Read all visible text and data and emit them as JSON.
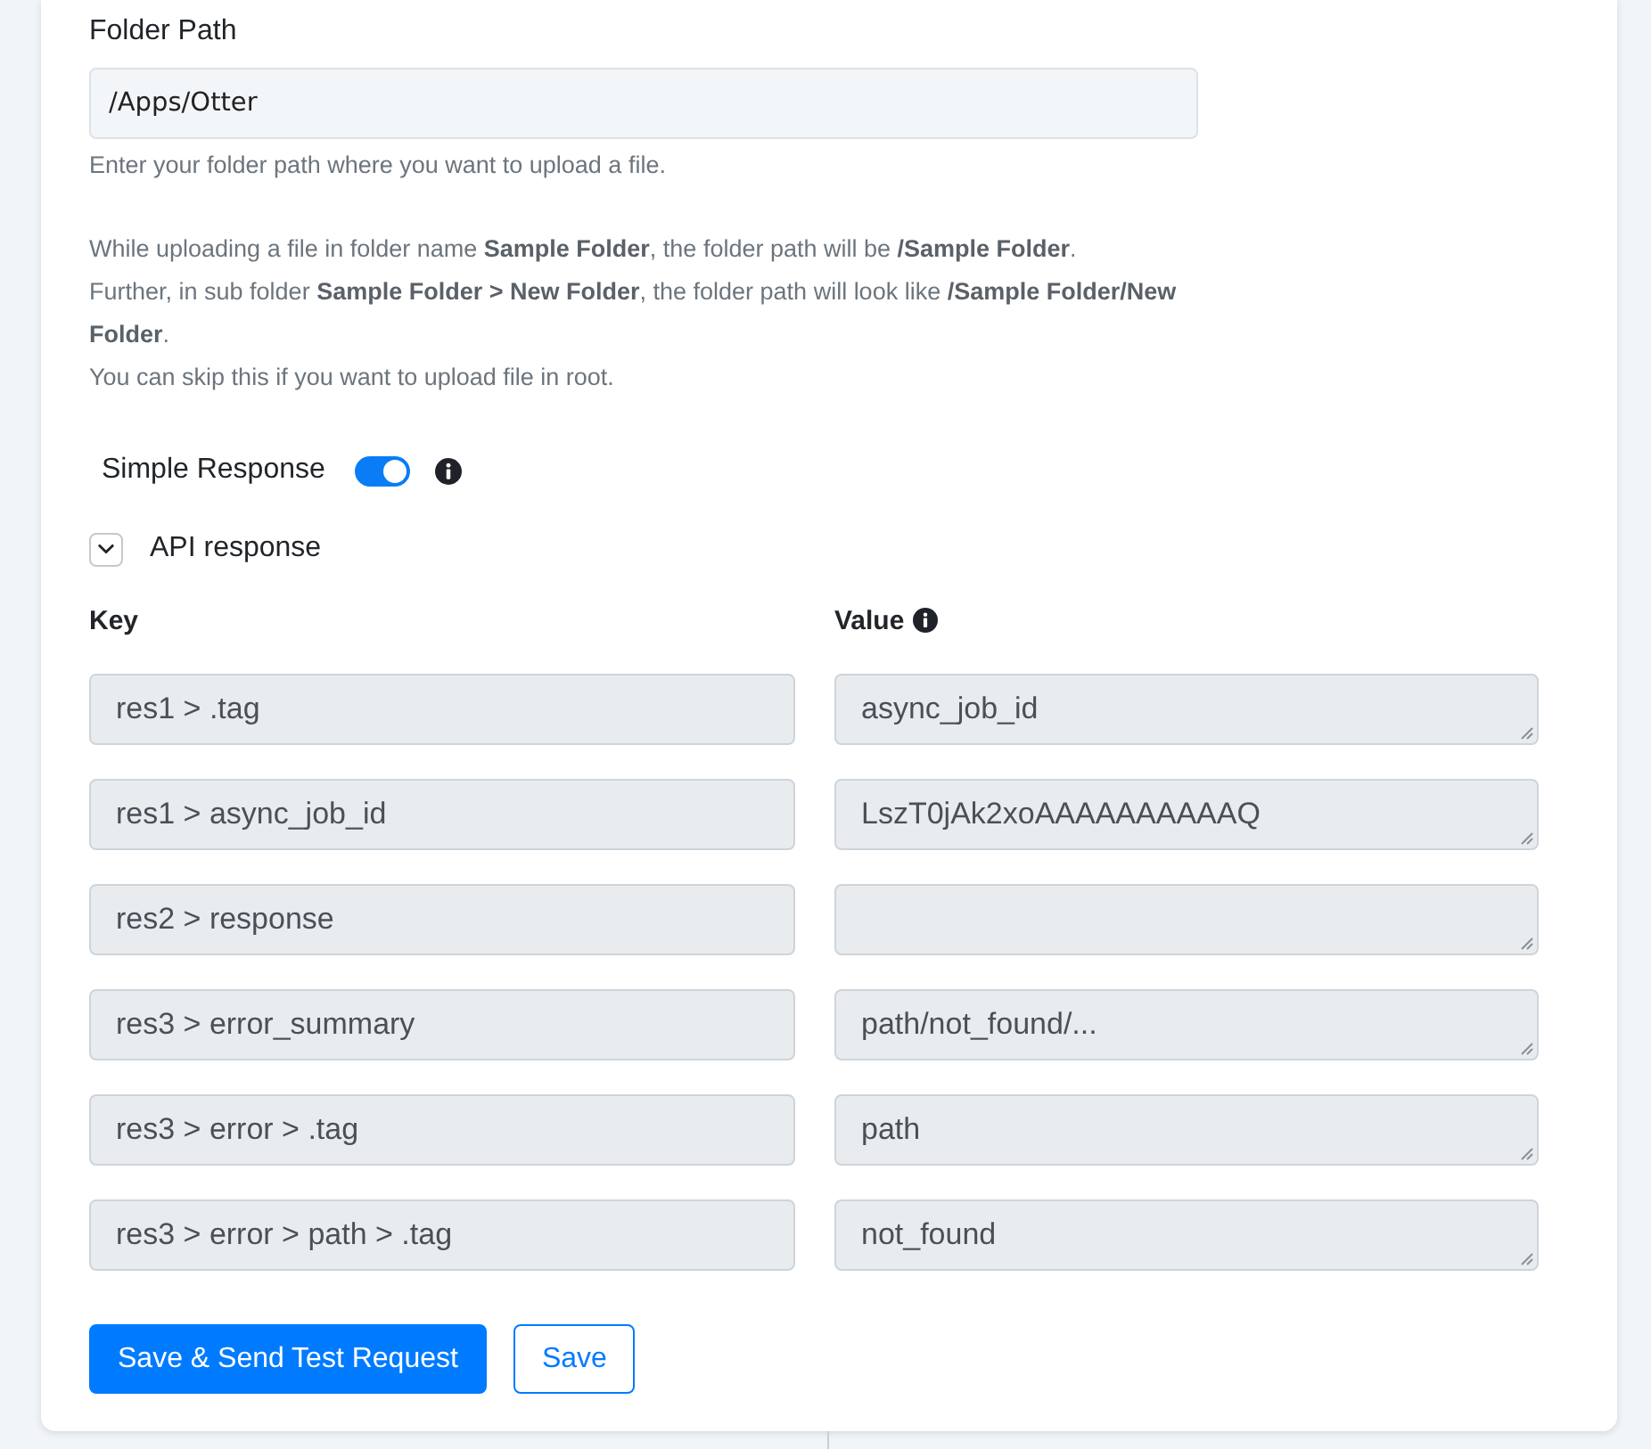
{
  "folder_path": {
    "label": "Folder Path",
    "value": "/Apps/Otter",
    "help": "Enter your folder path where you want to upload a file."
  },
  "notes": [
    "While uploading a file in folder name **Sample Folder**, the folder path will be **/Sample Folder**.",
    "Further, in sub folder **Sample Folder > New Folder**, the folder path will look like **/Sample Folder/New Folder**.",
    "You can skip this if you want to upload file in root."
  ],
  "simple_response": {
    "label": "Simple Response",
    "on": true
  },
  "api_response": {
    "label": "API response",
    "expanded": true,
    "columns": [
      {
        "label": "Key",
        "info": false
      },
      {
        "label": "Value",
        "info": true
      }
    ],
    "rows": [
      {
        "key": "res1 > .tag",
        "value": "async_job_id"
      },
      {
        "key": "res1 > async_job_id",
        "value": "LszT0jAk2xoAAAAAAAAAAQ"
      },
      {
        "key": "res2 > response"
      },
      {
        "key": "res3 > error_summary",
        "value": "path/not_found/..."
      },
      {
        "key": "res3 > error > .tag",
        "value": "path"
      },
      {
        "key": "res3 > error > path > .tag",
        "value": "not_found"
      }
    ]
  },
  "buttons": [
    {
      "label": "Save & Send Test Request",
      "kind": "primary"
    },
    {
      "label": "Save",
      "kind": "outline"
    }
  ]
}
